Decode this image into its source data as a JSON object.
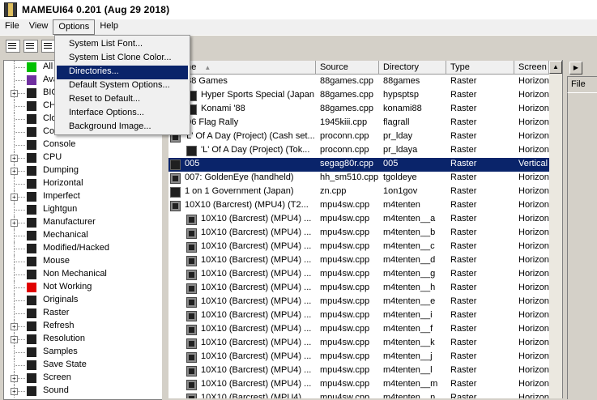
{
  "window": {
    "title": "MAMEUI64 0.201 (Aug 29 2018)"
  },
  "menubar": {
    "items": [
      "File",
      "View",
      "Options",
      "Help"
    ]
  },
  "options_menu": {
    "items": [
      "System List Font...",
      "System List Clone Color...",
      "Directories...",
      "Default System Options...",
      "Reset to Default...",
      "Interface Options...",
      "Background Image..."
    ],
    "highlighted": "Directories..."
  },
  "tree": {
    "items": [
      {
        "label": "All Systems",
        "icon_color": "#00c000",
        "expandable": false
      },
      {
        "label": "Available",
        "icon_color": "#7030a0",
        "expandable": false
      },
      {
        "label": "BIOS",
        "icon_color": "#202020",
        "expandable": true
      },
      {
        "label": "CHD",
        "icon_color": "#202020",
        "expandable": false
      },
      {
        "label": "Clones",
        "icon_color": "#202020",
        "expandable": false
      },
      {
        "label": "Container",
        "icon_color": "#202020",
        "expandable": false
      },
      {
        "label": "Console",
        "icon_color": "#202020",
        "expandable": false
      },
      {
        "label": "CPU",
        "icon_color": "#202020",
        "expandable": true
      },
      {
        "label": "Dumping",
        "icon_color": "#202020",
        "expandable": true
      },
      {
        "label": "Horizontal",
        "icon_color": "#202020",
        "expandable": false
      },
      {
        "label": "Imperfect",
        "icon_color": "#202020",
        "expandable": true
      },
      {
        "label": "Lightgun",
        "icon_color": "#202020",
        "expandable": false
      },
      {
        "label": "Manufacturer",
        "icon_color": "#202020",
        "expandable": true
      },
      {
        "label": "Mechanical",
        "icon_color": "#202020",
        "expandable": false
      },
      {
        "label": "Modified/Hacked",
        "icon_color": "#202020",
        "expandable": false
      },
      {
        "label": "Mouse",
        "icon_color": "#202020",
        "expandable": false
      },
      {
        "label": "Non Mechanical",
        "icon_color": "#202020",
        "expandable": false
      },
      {
        "label": "Not Working",
        "icon_color": "#e00000",
        "expandable": false
      },
      {
        "label": "Originals",
        "icon_color": "#202020",
        "expandable": false
      },
      {
        "label": "Raster",
        "icon_color": "#202020",
        "expandable": false
      },
      {
        "label": "Refresh",
        "icon_color": "#202020",
        "expandable": true
      },
      {
        "label": "Resolution",
        "icon_color": "#202020",
        "expandable": true
      },
      {
        "label": "Samples",
        "icon_color": "#202020",
        "expandable": false
      },
      {
        "label": "Save State",
        "icon_color": "#202020",
        "expandable": false
      },
      {
        "label": "Screen",
        "icon_color": "#202020",
        "expandable": true
      },
      {
        "label": "Sound",
        "icon_color": "#202020",
        "expandable": true
      }
    ]
  },
  "list": {
    "columns": [
      "Name",
      "Source",
      "Directory",
      "Type",
      "Screen"
    ],
    "rows": [
      {
        "name": "'88 Games",
        "source": "88games.cpp",
        "dir": "88games",
        "type": "Raster",
        "screen": "Horizon",
        "indent": 0,
        "icon": "gray"
      },
      {
        "name": "Hyper Sports Special (Japan)",
        "source": "88games.cpp",
        "dir": "hypsptsp",
        "type": "Raster",
        "screen": "Horizon",
        "indent": 1,
        "icon": "black"
      },
      {
        "name": "Konami '88",
        "source": "88games.cpp",
        "dir": "konami88",
        "type": "Raster",
        "screen": "Horizon",
        "indent": 1,
        "icon": "black"
      },
      {
        "name": "'96 Flag Rally",
        "source": "1945kiii.cpp",
        "dir": "flagrall",
        "type": "Raster",
        "screen": "Horizon",
        "indent": 0,
        "icon": "gray"
      },
      {
        "name": "'L' Of A Day (Project) (Cash set...",
        "source": "proconn.cpp",
        "dir": "pr_lday",
        "type": "Raster",
        "screen": "Horizon",
        "indent": 0,
        "icon": "gray"
      },
      {
        "name": "'L' Of A Day (Project) (Tok...",
        "source": "proconn.cpp",
        "dir": "pr_ldaya",
        "type": "Raster",
        "screen": "Horizon",
        "indent": 1,
        "icon": "black"
      },
      {
        "name": "005",
        "source": "segag80r.cpp",
        "dir": "005",
        "type": "Raster",
        "screen": "Vertical",
        "indent": 0,
        "icon": "black",
        "selected": true
      },
      {
        "name": "007: GoldenEye (handheld)",
        "source": "hh_sm510.cpp",
        "dir": "tgoldeye",
        "type": "Raster",
        "screen": "Horizon",
        "indent": 0,
        "icon": "gray"
      },
      {
        "name": "1 on 1 Government (Japan)",
        "source": "zn.cpp",
        "dir": "1on1gov",
        "type": "Raster",
        "screen": "Horizon",
        "indent": 0,
        "icon": "black"
      },
      {
        "name": "10X10 (Barcrest) (MPU4) (T2...",
        "source": "mpu4sw.cpp",
        "dir": "m4tenten",
        "type": "Raster",
        "screen": "Horizon",
        "indent": 0,
        "icon": "gray"
      },
      {
        "name": "10X10 (Barcrest) (MPU4) ...",
        "source": "mpu4sw.cpp",
        "dir": "m4tenten__a",
        "type": "Raster",
        "screen": "Horizon",
        "indent": 1,
        "icon": "gray"
      },
      {
        "name": "10X10 (Barcrest) (MPU4) ...",
        "source": "mpu4sw.cpp",
        "dir": "m4tenten__b",
        "type": "Raster",
        "screen": "Horizon",
        "indent": 1,
        "icon": "gray"
      },
      {
        "name": "10X10 (Barcrest) (MPU4) ...",
        "source": "mpu4sw.cpp",
        "dir": "m4tenten__c",
        "type": "Raster",
        "screen": "Horizon",
        "indent": 1,
        "icon": "gray"
      },
      {
        "name": "10X10 (Barcrest) (MPU4) ...",
        "source": "mpu4sw.cpp",
        "dir": "m4tenten__d",
        "type": "Raster",
        "screen": "Horizon",
        "indent": 1,
        "icon": "gray"
      },
      {
        "name": "10X10 (Barcrest) (MPU4) ...",
        "source": "mpu4sw.cpp",
        "dir": "m4tenten__g",
        "type": "Raster",
        "screen": "Horizon",
        "indent": 1,
        "icon": "gray"
      },
      {
        "name": "10X10 (Barcrest) (MPU4) ...",
        "source": "mpu4sw.cpp",
        "dir": "m4tenten__h",
        "type": "Raster",
        "screen": "Horizon",
        "indent": 1,
        "icon": "gray"
      },
      {
        "name": "10X10 (Barcrest) (MPU4) ...",
        "source": "mpu4sw.cpp",
        "dir": "m4tenten__e",
        "type": "Raster",
        "screen": "Horizon",
        "indent": 1,
        "icon": "gray"
      },
      {
        "name": "10X10 (Barcrest) (MPU4) ...",
        "source": "mpu4sw.cpp",
        "dir": "m4tenten__i",
        "type": "Raster",
        "screen": "Horizon",
        "indent": 1,
        "icon": "gray"
      },
      {
        "name": "10X10 (Barcrest) (MPU4) ...",
        "source": "mpu4sw.cpp",
        "dir": "m4tenten__f",
        "type": "Raster",
        "screen": "Horizon",
        "indent": 1,
        "icon": "gray"
      },
      {
        "name": "10X10 (Barcrest) (MPU4) ...",
        "source": "mpu4sw.cpp",
        "dir": "m4tenten__k",
        "type": "Raster",
        "screen": "Horizon",
        "indent": 1,
        "icon": "gray"
      },
      {
        "name": "10X10 (Barcrest) (MPU4) ...",
        "source": "mpu4sw.cpp",
        "dir": "m4tenten__j",
        "type": "Raster",
        "screen": "Horizon",
        "indent": 1,
        "icon": "gray"
      },
      {
        "name": "10X10 (Barcrest) (MPU4) ...",
        "source": "mpu4sw.cpp",
        "dir": "m4tenten__l",
        "type": "Raster",
        "screen": "Horizon",
        "indent": 1,
        "icon": "gray"
      },
      {
        "name": "10X10 (Barcrest) (MPU4) ...",
        "source": "mpu4sw.cpp",
        "dir": "m4tenten__m",
        "type": "Raster",
        "screen": "Horizon",
        "indent": 1,
        "icon": "gray"
      },
      {
        "name": "10X10 (Barcrest) (MPU4) ...",
        "source": "mpu4sw.cpp",
        "dir": "m4tenten__n",
        "type": "Raster",
        "screen": "Horizon",
        "indent": 1,
        "icon": "gray"
      }
    ]
  },
  "right_panel": {
    "tab_label": "File"
  },
  "colors": {
    "selection": "#0a246a",
    "background": "#d4d0c8"
  }
}
